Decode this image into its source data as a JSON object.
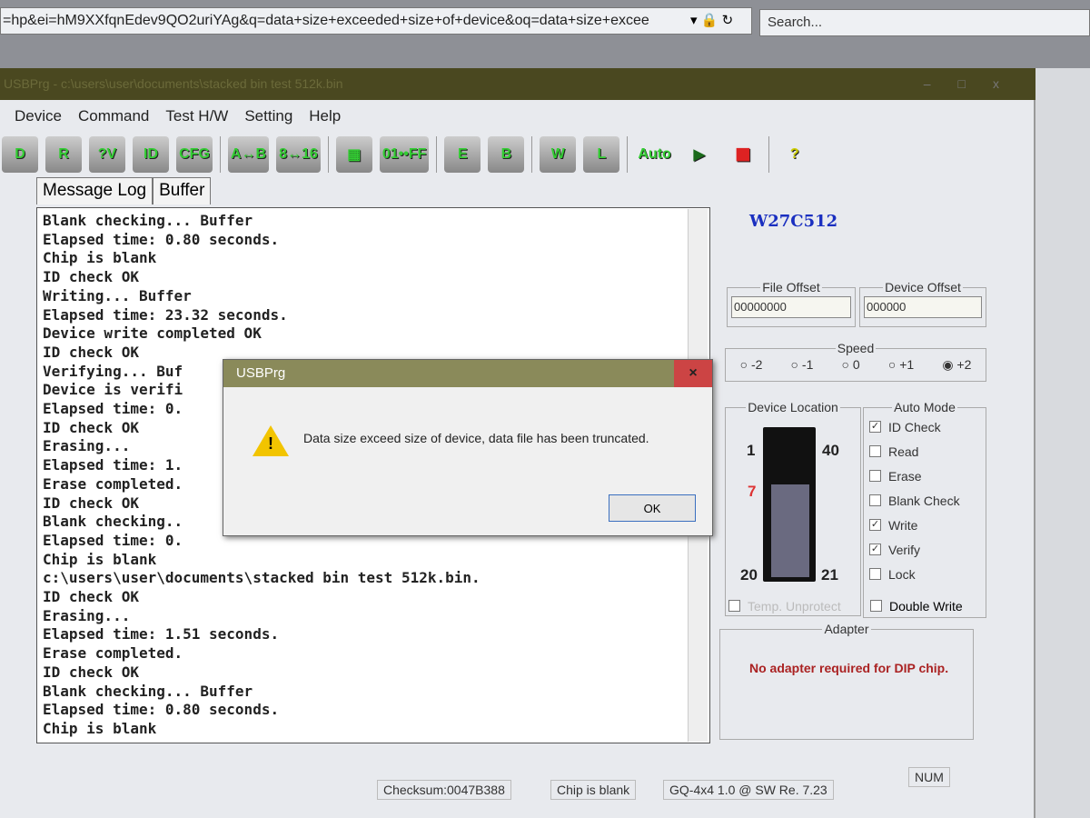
{
  "browser": {
    "url": "=hp&ei=hM9XXfqnEdev9QO2uriYAg&q=data+size+exceeded+size+of+device&oq=data+size+excee",
    "search_placeholder": "Search..."
  },
  "window": {
    "title": "USBPrg - c:\\users\\user\\documents\\stacked bin test 512k.bin"
  },
  "menu": [
    "Device",
    "Command",
    "Test H/W",
    "Setting",
    "Help"
  ],
  "toolbar": [
    {
      "label": "D"
    },
    {
      "label": "R"
    },
    {
      "label": "?V"
    },
    {
      "label": "ID"
    },
    {
      "label": "CFG"
    },
    {
      "label": "A↔B"
    },
    {
      "label": "8↔16"
    },
    {
      "label": "▦"
    },
    {
      "label": "01••FF"
    },
    {
      "label": "E"
    },
    {
      "label": "B"
    },
    {
      "label": "W"
    },
    {
      "label": "L"
    },
    {
      "label": "Auto"
    },
    {
      "label": "▶"
    },
    {
      "label": "■"
    },
    {
      "label": "?"
    }
  ],
  "tabs": [
    "Message Log",
    "Buffer"
  ],
  "log": [
    "Blank checking... Buffer",
    "Elapsed time: 0.80 seconds.",
    "Chip is blank",
    "ID check OK",
    "Writing... Buffer",
    "Elapsed time: 23.32 seconds.",
    "Device write completed OK",
    "ID check OK",
    "Verifying... Buf",
    "Device is verifi",
    "Elapsed time: 0.",
    "ID check OK",
    "Erasing...",
    "Elapsed time: 1.",
    "Erase completed.",
    "ID check OK",
    "Blank checking..",
    "Elapsed time: 0.",
    "Chip is blank",
    "c:\\users\\user\\documents\\stacked bin test 512k.bin.",
    "ID check OK",
    "Erasing...",
    "Elapsed time: 1.51 seconds.",
    "Erase completed.",
    "ID check OK",
    "Blank checking... Buffer",
    "Elapsed time: 0.80 seconds.",
    "Chip is blank"
  ],
  "dialog": {
    "title": "USBPrg",
    "message": "Data size exceed size of device, data file has been truncated.",
    "ok": "OK",
    "icon": "warning-icon"
  },
  "panel": {
    "chip": "W27C512",
    "file_offset_label": "File Offset",
    "file_offset": "00000000",
    "device_offset_label": "Device Offset",
    "device_offset": "000000",
    "speed_label": "Speed",
    "speeds": [
      "-2",
      "-1",
      "0",
      "+1",
      "+2"
    ],
    "speed_selected": "+2",
    "device_location_label": "Device Location",
    "pins": {
      "tl": "1",
      "tr": "40",
      "mark": "7",
      "bl": "20",
      "br": "21"
    },
    "temp_unprotect": "Temp. Unprotect",
    "auto_mode_label": "Auto Mode",
    "auto_mode": [
      {
        "label": "ID Check",
        "checked": true
      },
      {
        "label": "Read",
        "checked": false
      },
      {
        "label": "Erase",
        "checked": false
      },
      {
        "label": "Blank Check",
        "checked": false
      },
      {
        "label": "Write",
        "checked": true
      },
      {
        "label": "Verify",
        "checked": true
      },
      {
        "label": "Lock",
        "checked": false
      }
    ],
    "double_write": "Double Write",
    "adapter_label": "Adapter",
    "adapter_msg": "No adapter required for DIP chip."
  },
  "status": {
    "checksum": "Checksum:0047B388",
    "chip_state": "Chip is blank",
    "version": "GQ-4x4 1.0 @ SW Re. 7.23",
    "num": "NUM"
  },
  "colors": {
    "chip_name": "#1a2fc0",
    "adapter_msg": "#a22222",
    "titlebar": "#4a4820"
  }
}
